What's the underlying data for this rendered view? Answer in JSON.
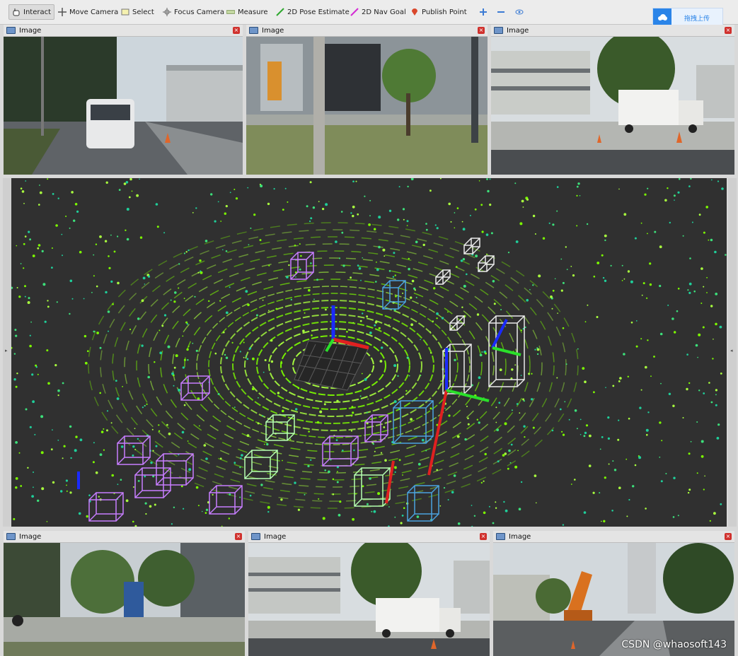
{
  "toolbar": {
    "interact": "Interact",
    "move_camera": "Move Camera",
    "select": "Select",
    "focus_camera": "Focus Camera",
    "measure": "Measure",
    "pose_estimate": "2D Pose Estimate",
    "nav_goal": "2D Nav Goal",
    "publish_point": "Publish Point",
    "upload_label": "拖拽上传"
  },
  "panels": {
    "top_left": {
      "title": "Image",
      "close": "×"
    },
    "top_mid": {
      "title": "Image",
      "close": "×"
    },
    "top_right": {
      "title": "Image",
      "close": "×"
    },
    "bot_left": {
      "title": "Image",
      "close": "×"
    },
    "bot_mid": {
      "title": "Image",
      "close": "×"
    },
    "bot_right": {
      "title": "Image",
      "close": "×"
    }
  },
  "view3d": {
    "background": "#303030",
    "point_colors": [
      "#7CFC00",
      "#3CE07A",
      "#1FCF9A",
      "#A8FF3E"
    ],
    "box_colors": [
      "#c77dff",
      "#eaeaea",
      "#4aa3df",
      "#b5ffb0"
    ]
  },
  "watermark": "CSDN @whaosoft143"
}
